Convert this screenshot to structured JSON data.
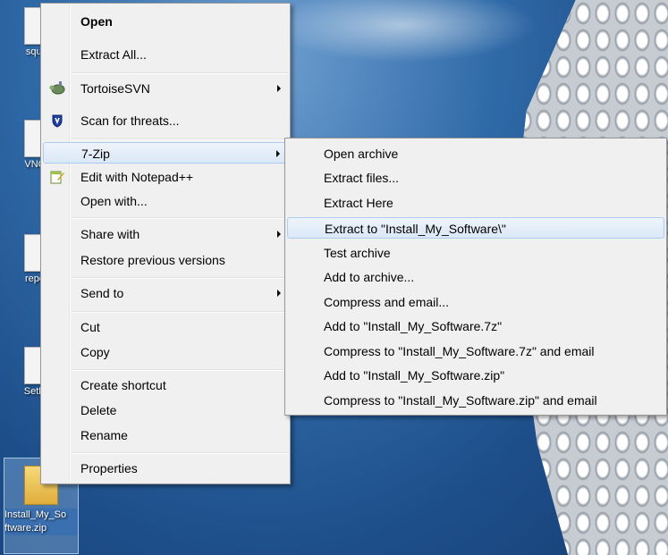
{
  "desktop": {
    "icons": [
      {
        "label": "squi"
      },
      {
        "label": "VNC"
      },
      {
        "label": "repo"
      },
      {
        "label": "SetH"
      }
    ],
    "selected_file": {
      "label_line1": "Install_My_So",
      "label_line2": "ftware.zip"
    }
  },
  "context_menu": {
    "open": "Open",
    "extract_all": "Extract All...",
    "tortoisesvn": "TortoiseSVN",
    "scan": "Scan for threats...",
    "seven_zip": "7-Zip",
    "notepad": "Edit with Notepad++",
    "open_with": "Open with...",
    "share_with": "Share with",
    "restore": "Restore previous versions",
    "send_to": "Send to",
    "cut": "Cut",
    "copy": "Copy",
    "create_shortcut": "Create shortcut",
    "delete": "Delete",
    "rename": "Rename",
    "properties": "Properties"
  },
  "submenu_7zip": {
    "items": [
      "Open archive",
      "Extract files...",
      "Extract Here",
      "Extract to \"Install_My_Software\\\"",
      "Test archive",
      "Add to archive...",
      "Compress and email...",
      "Add to \"Install_My_Software.7z\"",
      "Compress to \"Install_My_Software.7z\" and email",
      "Add to \"Install_My_Software.zip\"",
      "Compress to \"Install_My_Software.zip\" and email"
    ]
  },
  "icons": {
    "tortoisesvn": "tortoise-icon",
    "scan": "shield-icon",
    "notepad": "notepad-icon"
  }
}
